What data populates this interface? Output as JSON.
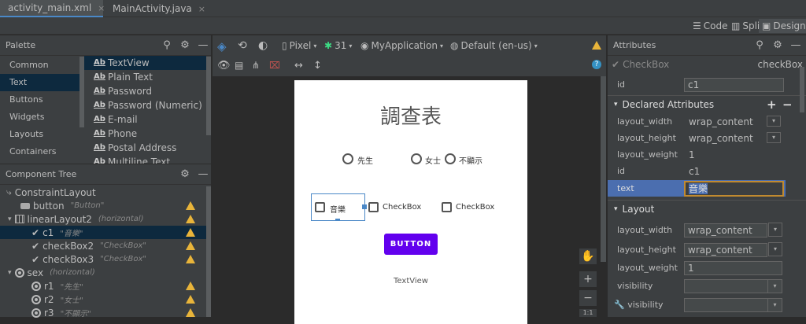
{
  "tabs": [
    {
      "label": "activity_main.xml",
      "close": "×",
      "icon": "xml-file-icon"
    },
    {
      "label": "MainActivity.java",
      "close": "×",
      "icon": "java-class-icon"
    }
  ],
  "view_modes": {
    "code": "Code",
    "split": "Split",
    "design": "Design",
    "active": "Design"
  },
  "palette": {
    "title": "Palette",
    "categories": [
      "Common",
      "Text",
      "Buttons",
      "Widgets",
      "Layouts",
      "Containers"
    ],
    "selected_category": "Text",
    "items": [
      {
        "icon": "Ab",
        "label": "TextView"
      },
      {
        "icon": "Ab",
        "label": "Plain Text"
      },
      {
        "icon": "Ab",
        "label": "Password"
      },
      {
        "icon": "Ab",
        "label": "Password (Numeric)"
      },
      {
        "icon": "Ab",
        "label": "E-mail"
      },
      {
        "icon": "Ab",
        "label": "Phone"
      },
      {
        "icon": "Ab",
        "label": "Postal Address"
      },
      {
        "icon": "Ab",
        "label": "Multiline Text"
      }
    ]
  },
  "component_tree": {
    "title": "Component Tree",
    "nodes": [
      {
        "label": "ConstraintLayout",
        "sub": "",
        "warn": false
      },
      {
        "label": "button",
        "sub": "\"Button\"",
        "warn": true
      },
      {
        "label": "linearLayout2",
        "sub": "(horizontal)",
        "warn": true
      },
      {
        "label": "c1",
        "sub": "\"音樂\"",
        "warn": true
      },
      {
        "label": "checkBox2",
        "sub": "\"CheckBox\"",
        "warn": true
      },
      {
        "label": "checkBox3",
        "sub": "\"CheckBox\"",
        "warn": true
      },
      {
        "label": "sex",
        "sub": "(horizontal)",
        "warn": false
      },
      {
        "label": "r1",
        "sub": "\"先生\"",
        "warn": true
      },
      {
        "label": "r2",
        "sub": "\"女士\"",
        "warn": true
      },
      {
        "label": "r3",
        "sub": "\"不顯示\"",
        "warn": true
      }
    ]
  },
  "design_toolbar": {
    "device": "Pixel",
    "api": "31",
    "app": "MyApplication",
    "locale": "Default (en-us)"
  },
  "preview": {
    "title": "調查表",
    "radios": [
      "先生",
      "女士",
      "不顯示"
    ],
    "checkboxes": [
      "音樂",
      "CheckBox",
      "CheckBox"
    ],
    "button": "BUTTON",
    "textview": "TextView",
    "button_color": "#6200ee"
  },
  "attributes": {
    "title": "Attributes",
    "widget_type": "CheckBox",
    "widget_id": "checkBox",
    "id_label": "id",
    "id_value": "c1",
    "declared_title": "Declared Attributes",
    "declared": [
      {
        "name": "layout_width",
        "value": "wrap_content",
        "dropdown": true
      },
      {
        "name": "layout_height",
        "value": "wrap_content",
        "dropdown": true
      },
      {
        "name": "layout_weight",
        "value": "1",
        "dropdown": false
      },
      {
        "name": "id",
        "value": "c1",
        "dropdown": false
      },
      {
        "name": "text",
        "value": "音樂",
        "dropdown": false
      }
    ],
    "layout_title": "Layout",
    "layout": [
      {
        "name": "layout_width",
        "value": "wrap_content",
        "dropdown": true
      },
      {
        "name": "layout_height",
        "value": "wrap_content",
        "dropdown": true
      },
      {
        "name": "layout_weight",
        "value": "1",
        "dropdown": false
      },
      {
        "name": "visibility",
        "value": "",
        "dropdown": true
      },
      {
        "name": "visibility",
        "value": "",
        "dropdown": true
      }
    ]
  },
  "zoom": {
    "plus": "+",
    "minus": "−",
    "ratio": "1:1"
  },
  "accent": "#4a88c7",
  "warning_color": "#e8b43a"
}
